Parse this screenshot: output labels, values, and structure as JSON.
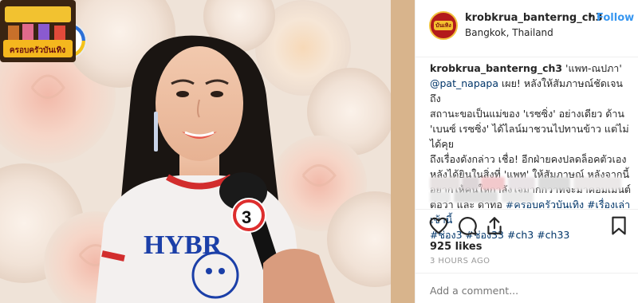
{
  "media": {
    "channel_logo_text": "3",
    "show_logo_text": "ครอบครัวบันเทิง",
    "shirt_text": "HYBR"
  },
  "header": {
    "username": "krobkrua_banterng_ch3",
    "separator": "•",
    "follow_label": "Follow",
    "location": "Bangkok, Thailand",
    "avatar_text": "บันเทิง"
  },
  "caption": {
    "username": "krobkrua_banterng_ch3",
    "lines": [
      " 'แพท-ณปภา'",
      "เผย! หลังให้สัมภาษณ์ชัดเจน ถึง",
      "สถานะขอเป็นแม่ของ 'เรซซิ่ง' อย่างเดียว ด้าน",
      "'เบนซ์ เรซซิ่ง' ได้ไลน์มาชวนไปทานข้าว แต่ไม่ได้คุย",
      "ถึงเรื่องดังกล่าว เชื่อ! อีกฝ่ายคงปลดล็อคตัวเอง",
      "หลังได้ยินในสิ่งที่ 'แพท' ให้สัมภาษณ์ หลังจากนี้",
      "อยากให้คนให้กำลังใจมากกว่าที่จะมาคอมเมนต์",
      "ต่อว่า และ ด่าทอ "
    ],
    "mention": "@pat_napapa",
    "hashtags": [
      "#ครอบครัวบันเทิง",
      "#เรื่องเล่าเช้านี้",
      "#ช่อง3",
      "#ช่อง33",
      "#ch3",
      "#ch33"
    ]
  },
  "actions": {
    "like_icon": "heart-icon",
    "comment_icon": "comment-icon",
    "share_icon": "share-icon",
    "save_icon": "bookmark-icon"
  },
  "stats": {
    "likes": "925 likes",
    "time_ago": "3 HOURS AGO"
  },
  "comment": {
    "placeholder": "Add a comment..."
  },
  "colors": {
    "accent_blue": "#3897f0",
    "link": "#003569",
    "muted": "#999999"
  }
}
